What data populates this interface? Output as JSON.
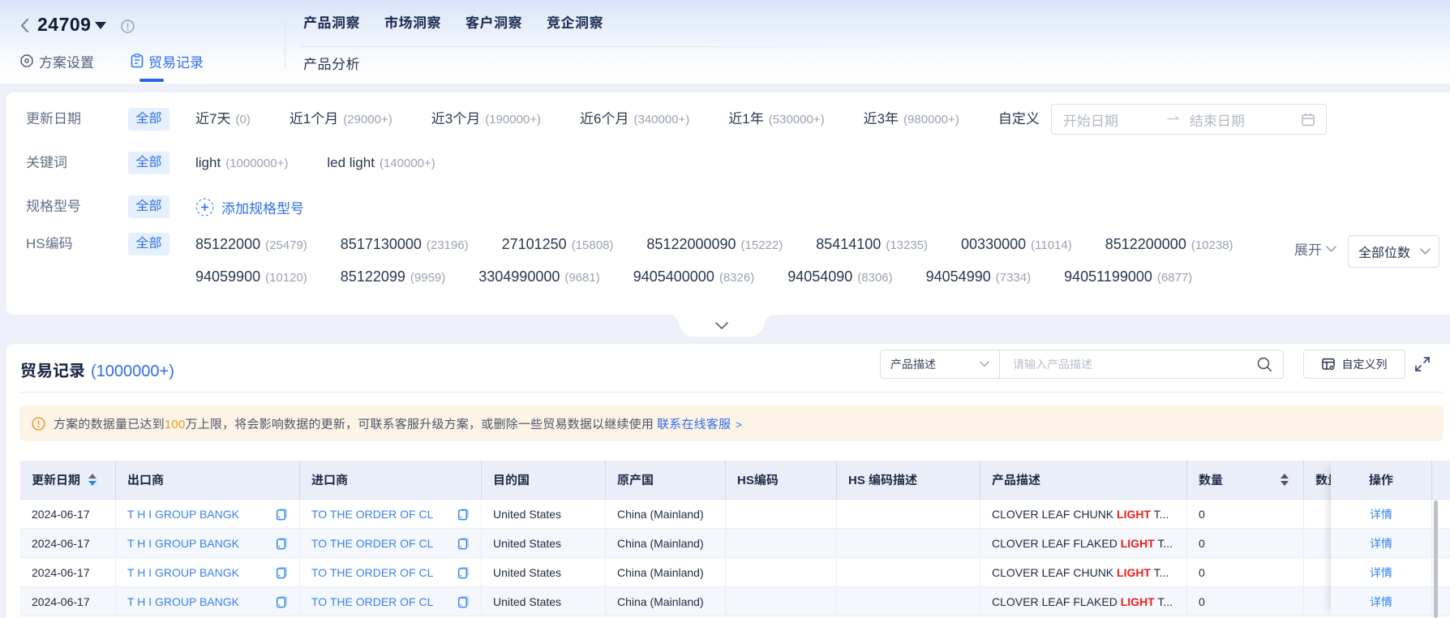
{
  "colors": {
    "primary_blue": "#2e6fe5",
    "link_blue": "#3b82ea",
    "chip_bg": "#e6f0fc",
    "warning_orange": "#ee9a2d",
    "banner_bg": "#fdf3e6",
    "highlight_red": "#e8221d",
    "header_gradient_top": "#d6e3f8",
    "table_header_bg": "#e9eef8",
    "zebra_row_bg": "#f4f7fc"
  },
  "header": {
    "plan_id": "24709",
    "tabs": [
      {
        "label": "方案设置"
      },
      {
        "label": "贸易记录"
      }
    ],
    "nav": [
      {
        "label": "产品洞察"
      },
      {
        "label": "市场洞察"
      },
      {
        "label": "客户洞察"
      },
      {
        "label": "竞企洞察"
      }
    ],
    "subnav": "产品分析"
  },
  "filters": {
    "update_date": {
      "label": "更新日期",
      "all": "全部",
      "options": [
        {
          "name": "近7天",
          "count": "(0)"
        },
        {
          "name": "近1个月",
          "count": "(29000+)"
        },
        {
          "name": "近3个月",
          "count": "(190000+)"
        },
        {
          "name": "近6个月",
          "count": "(340000+)"
        },
        {
          "name": "近1年",
          "count": "(530000+)"
        },
        {
          "name": "近3年",
          "count": "(980000+)"
        }
      ],
      "custom": "自定义",
      "start_placeholder": "开始日期",
      "end_placeholder": "结束日期"
    },
    "keyword": {
      "label": "关键词",
      "all": "全部",
      "options": [
        {
          "name": "light",
          "count": "(1000000+)"
        },
        {
          "name": "led light",
          "count": "(140000+)"
        }
      ]
    },
    "spec": {
      "label": "规格型号",
      "all": "全部",
      "add_label": "添加规格型号"
    },
    "hs_code": {
      "label": "HS编码",
      "all": "全部",
      "row1": [
        {
          "name": "85122000",
          "count": "(25479)"
        },
        {
          "name": "8517130000",
          "count": "(23196)"
        },
        {
          "name": "27101250",
          "count": "(15808)"
        },
        {
          "name": "85122000090",
          "count": "(15222)"
        },
        {
          "name": "85414100",
          "count": "(13235)"
        },
        {
          "name": "00330000",
          "count": "(11014)"
        },
        {
          "name": "8512200000",
          "count": "(10238)"
        }
      ],
      "row2": [
        {
          "name": "94059900",
          "count": "(10120)"
        },
        {
          "name": "85122099",
          "count": "(9959)"
        },
        {
          "name": "3304990000",
          "count": "(9681)"
        },
        {
          "name": "9405400000",
          "count": "(8326)"
        },
        {
          "name": "94054090",
          "count": "(8306)"
        },
        {
          "name": "94054990",
          "count": "(7334)"
        },
        {
          "name": "94051199000",
          "count": "(6877)"
        }
      ]
    },
    "expand": "展开",
    "digits_select": "全部位数"
  },
  "records": {
    "title": "贸易记录",
    "count": "(1000000+)",
    "toolbar": {
      "field_select": "产品描述",
      "search_placeholder": "请输入产品描述",
      "customize_columns": "自定义列"
    },
    "banner": {
      "text_before": "方案的数据量已达到",
      "highlight": "100",
      "text_after": "万上限，将会影响数据的更新，可联系客服升级方案，或删除一些贸易数据以继续使用",
      "link": "联系在线客服",
      "arrow": ">"
    },
    "table": {
      "columns": {
        "update_date": "更新日期",
        "exporter": "出口商",
        "importer": "进口商",
        "destination": "目的国",
        "origin": "原产国",
        "hs_code": "HS编码",
        "hs_desc": "HS 编码描述",
        "product": "产品描述",
        "quantity": "数量",
        "quantity_unit": "数量",
        "action": "操作"
      },
      "rows": [
        {
          "date": "2024-06-17",
          "exporter": "T H I GROUP BANGK",
          "importer": "TO THE ORDER OF CL",
          "destination": "United States",
          "origin": "China (Mainland)",
          "hs_code": "",
          "hs_desc": "",
          "product_before": "CLOVER LEAF CHUNK ",
          "product_highlight": "LIGHT",
          "product_after": " T...",
          "quantity": "0",
          "action": "详情"
        },
        {
          "date": "2024-06-17",
          "exporter": "T H I GROUP BANGK",
          "importer": "TO THE ORDER OF CL",
          "destination": "United States",
          "origin": "China (Mainland)",
          "hs_code": "",
          "hs_desc": "",
          "product_before": "CLOVER LEAF FLAKED ",
          "product_highlight": "LIGHT",
          "product_after": " T...",
          "quantity": "0",
          "action": "详情"
        },
        {
          "date": "2024-06-17",
          "exporter": "T H I GROUP BANGK",
          "importer": "TO THE ORDER OF CL",
          "destination": "United States",
          "origin": "China (Mainland)",
          "hs_code": "",
          "hs_desc": "",
          "product_before": "CLOVER LEAF CHUNK ",
          "product_highlight": "LIGHT",
          "product_after": " T...",
          "quantity": "0",
          "action": "详情"
        },
        {
          "date": "2024-06-17",
          "exporter": "T H I GROUP BANGK",
          "importer": "TO THE ORDER OF CL",
          "destination": "United States",
          "origin": "China (Mainland)",
          "hs_code": "",
          "hs_desc": "",
          "product_before": "CLOVER LEAF FLAKED ",
          "product_highlight": "LIGHT",
          "product_after": " T...",
          "quantity": "0",
          "action": "详情"
        }
      ]
    }
  }
}
